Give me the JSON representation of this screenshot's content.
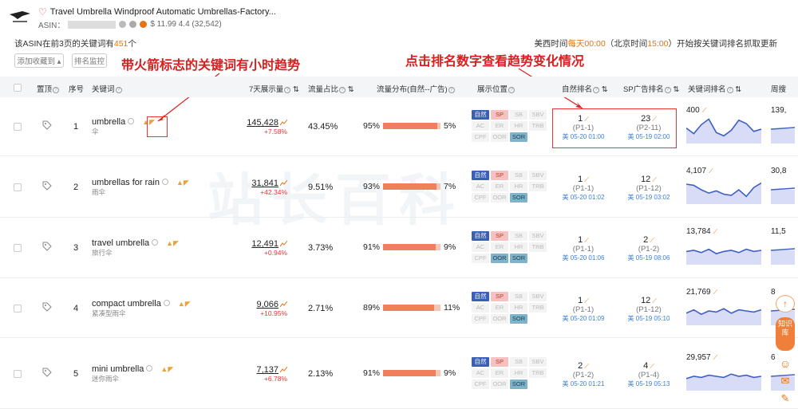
{
  "header": {
    "title": "Travel Umbrella Windproof Automatic Umbrellas-Factory...",
    "asin_label": "ASIN：",
    "price_rating": "$ 11.99  4.4 (32,542)"
  },
  "info": {
    "prefix": "该ASIN在前3页的关键词有",
    "count": "451",
    "suffix": "个"
  },
  "time_note": {
    "p1": "美西时间",
    "p2": "每天00:00",
    "p3": "（北京时间",
    "p4": "15:00",
    "p5": "）开始按关键词排名抓取更新"
  },
  "toolbar": {
    "add_favorite": "添加收藏到 ▴",
    "rank_monitor": "排名监控"
  },
  "annotations": {
    "fire_note": "带火箭标志的关键词有小时趋势",
    "rank_note": "点击排名数字查看趋势变化情况"
  },
  "columns": {
    "pin": "置顶",
    "index": "序号",
    "keyword": "关键词",
    "impressions": "7天展示量",
    "share": "流量占比",
    "distribution": "流量分布(自然--广告)",
    "placement": "展示位置",
    "organic_rank": "自然排名",
    "sp_rank": "SP广告排名",
    "kw_rank": "关键词排名",
    "weekly": "周搜"
  },
  "colors": {
    "accent_orange": "#e8730f",
    "annotation_red": "#d81e1e",
    "bar_fill": "#f07f5d",
    "spark_line": "#3f5fc4"
  },
  "rows": [
    {
      "idx": "1",
      "kw": "umbrella",
      "kw_cn": "伞",
      "imp": "145,428",
      "imp_chg": "+7.58%",
      "share": "43.45%",
      "org_pct": "95%",
      "ad_pct": "5%",
      "org_val": 95,
      "org_rank": "1",
      "org_page": "(P1-1)",
      "org_time": "美 05-20 01:00",
      "sp_rank": "23",
      "sp_page": "(P2-11)",
      "sp_time": "美 05-19 02:00",
      "kw_rank": "400",
      "weekly": "139,",
      "spark": [
        0.55,
        0.3,
        0.7,
        0.95,
        0.35,
        0.2,
        0.45,
        0.9,
        0.75,
        0.4,
        0.5
      ]
    },
    {
      "idx": "2",
      "kw": "umbrellas for rain",
      "kw_cn": "雨伞",
      "imp": "31,841",
      "imp_chg": "+42.34%",
      "share": "9.51%",
      "org_pct": "93%",
      "ad_pct": "7%",
      "org_val": 93,
      "org_rank": "1",
      "org_page": "(P1-1)",
      "org_time": "美 05-20 01:02",
      "sp_rank": "12",
      "sp_page": "(P1-12)",
      "sp_time": "美 05-19 03:02",
      "kw_rank": "4,107",
      "weekly": "30,8",
      "spark": [
        0.75,
        0.7,
        0.5,
        0.35,
        0.45,
        0.3,
        0.25,
        0.5,
        0.2,
        0.6,
        0.8
      ]
    },
    {
      "idx": "3",
      "kw": "travel umbrella",
      "kw_cn": "旅行伞",
      "imp": "12,491",
      "imp_chg": "+0.94%",
      "share": "3.73%",
      "org_pct": "91%",
      "ad_pct": "9%",
      "org_val": 91,
      "org_rank": "1",
      "org_page": "(P1-1)",
      "org_time": "美 05-20 01:06",
      "sp_rank": "2",
      "sp_page": "(P1-2)",
      "sp_time": "美 05-19 08:06",
      "kw_rank": "13,784",
      "weekly": "11,5",
      "spark": [
        0.45,
        0.5,
        0.4,
        0.55,
        0.35,
        0.45,
        0.5,
        0.4,
        0.55,
        0.45,
        0.5
      ]
    },
    {
      "idx": "4",
      "kw": "compact umbrella",
      "kw_cn": "紧凑型雨伞",
      "imp": "9,066",
      "imp_chg": "+10.95%",
      "share": "2.71%",
      "org_pct": "89%",
      "ad_pct": "11%",
      "org_val": 89,
      "org_rank": "1",
      "org_page": "(P1-1)",
      "org_time": "美 05-20 01:09",
      "sp_rank": "12",
      "sp_page": "(P1-12)",
      "sp_time": "美 05-19 05:10",
      "kw_rank": "21,769",
      "weekly": "8",
      "spark": [
        0.4,
        0.55,
        0.35,
        0.5,
        0.45,
        0.6,
        0.4,
        0.55,
        0.5,
        0.45,
        0.55
      ]
    },
    {
      "idx": "5",
      "kw": "mini umbrella",
      "kw_cn": "迷你雨伞",
      "imp": "7,137",
      "imp_chg": "+6.78%",
      "share": "2.13%",
      "org_pct": "91%",
      "ad_pct": "9%",
      "org_val": 91,
      "org_rank": "2",
      "org_page": "(P1-2)",
      "org_time": "美 05-20 01:21",
      "sp_rank": "4",
      "sp_page": "(P1-4)",
      "sp_time": "美 05-19 05:13",
      "kw_rank": "29,957",
      "weekly": "6",
      "spark": [
        0.4,
        0.5,
        0.45,
        0.55,
        0.5,
        0.45,
        0.6,
        0.5,
        0.55,
        0.45,
        0.5
      ]
    }
  ],
  "placements": [
    "自然",
    "SP",
    "SB",
    "SBV",
    "AC",
    "ER",
    "HR",
    "TRB",
    "CPF",
    "OOR",
    "SOR"
  ],
  "placement_active": [
    [
      "on-blue",
      "on-red",
      "off",
      "off",
      "off",
      "off",
      "off",
      "off",
      "off",
      "off",
      "on-teal"
    ],
    [
      "on-blue",
      "on-red",
      "off",
      "off",
      "off",
      "off",
      "off",
      "off",
      "off",
      "off",
      "on-teal"
    ],
    [
      "on-blue",
      "on-red",
      "off",
      "off",
      "off",
      "off",
      "off",
      "off",
      "off",
      "on-teal",
      "on-teal"
    ],
    [
      "on-blue",
      "on-red",
      "off",
      "off",
      "off",
      "off",
      "off",
      "off",
      "off",
      "off",
      "on-teal"
    ],
    [
      "on-blue",
      "on-red",
      "off",
      "off",
      "off",
      "off",
      "off",
      "off",
      "off",
      "off",
      "on-teal"
    ]
  ],
  "side": {
    "kb": "知识库"
  },
  "watermark": "站长百科"
}
